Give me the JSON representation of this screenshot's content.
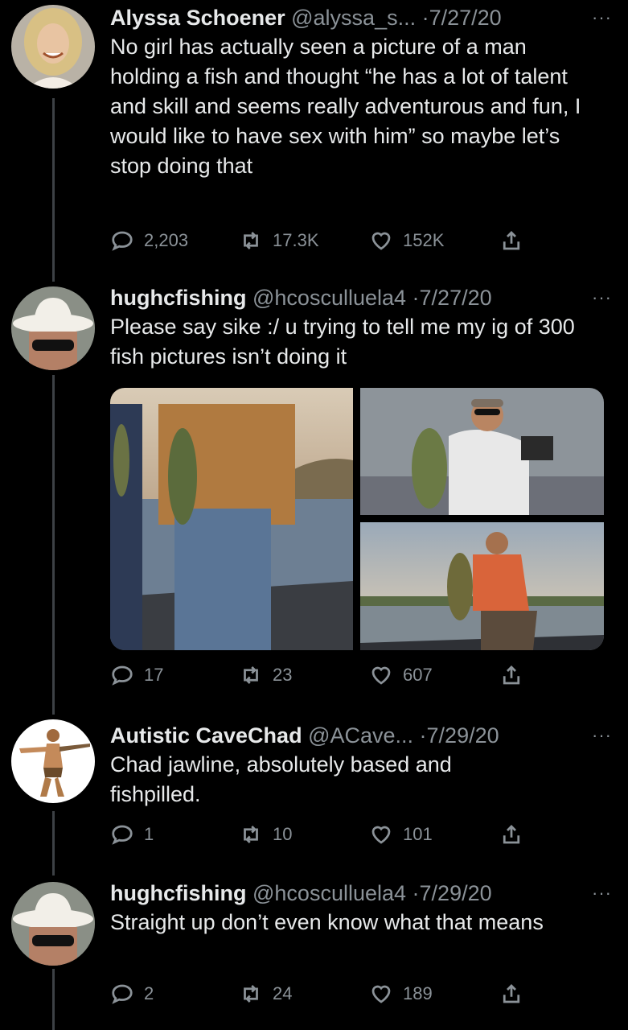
{
  "tweets": [
    {
      "name": "Alyssa Schoener",
      "handle": "@alyssa_s...",
      "date": "·7/27/20",
      "more": "···",
      "text": "No girl has actually seen a picture of a man holding a fish and thought “he has a lot of talent and skill and seems really adventurous and fun, I would like to have sex with him” so maybe let’s stop doing that",
      "replies": "2,203",
      "retweets": "17.3K",
      "likes": "152K"
    },
    {
      "name": "hughcfishing",
      "handle": "@hcosculluela4",
      "date": "·7/27/20",
      "more": "···",
      "text": "Please say sike :/ u trying to tell me my ig of 300 fish pictures isn’t doing it",
      "replies": "17",
      "retweets": "23",
      "likes": "607"
    },
    {
      "name": "Autistic CaveChad",
      "handle": "@ACave...",
      "date": "·7/29/20",
      "more": "···",
      "text": "Chad jawline, absolutely based and fishpilled.",
      "replies": "1",
      "retweets": "10",
      "likes": "101"
    },
    {
      "name": "hughcfishing",
      "handle": "@hcosculluela4",
      "date": "·7/29/20",
      "more": "···",
      "text": "Straight up don’t even know what that means",
      "replies": "2",
      "retweets": "24",
      "likes": "189"
    }
  ],
  "icons": {
    "reply": "reply-icon",
    "retweet": "retweet-icon",
    "like": "heart-icon",
    "share": "share-icon"
  },
  "colors": {
    "background": "#000000",
    "text": "#e7e9ea",
    "muted": "#8b9298"
  }
}
